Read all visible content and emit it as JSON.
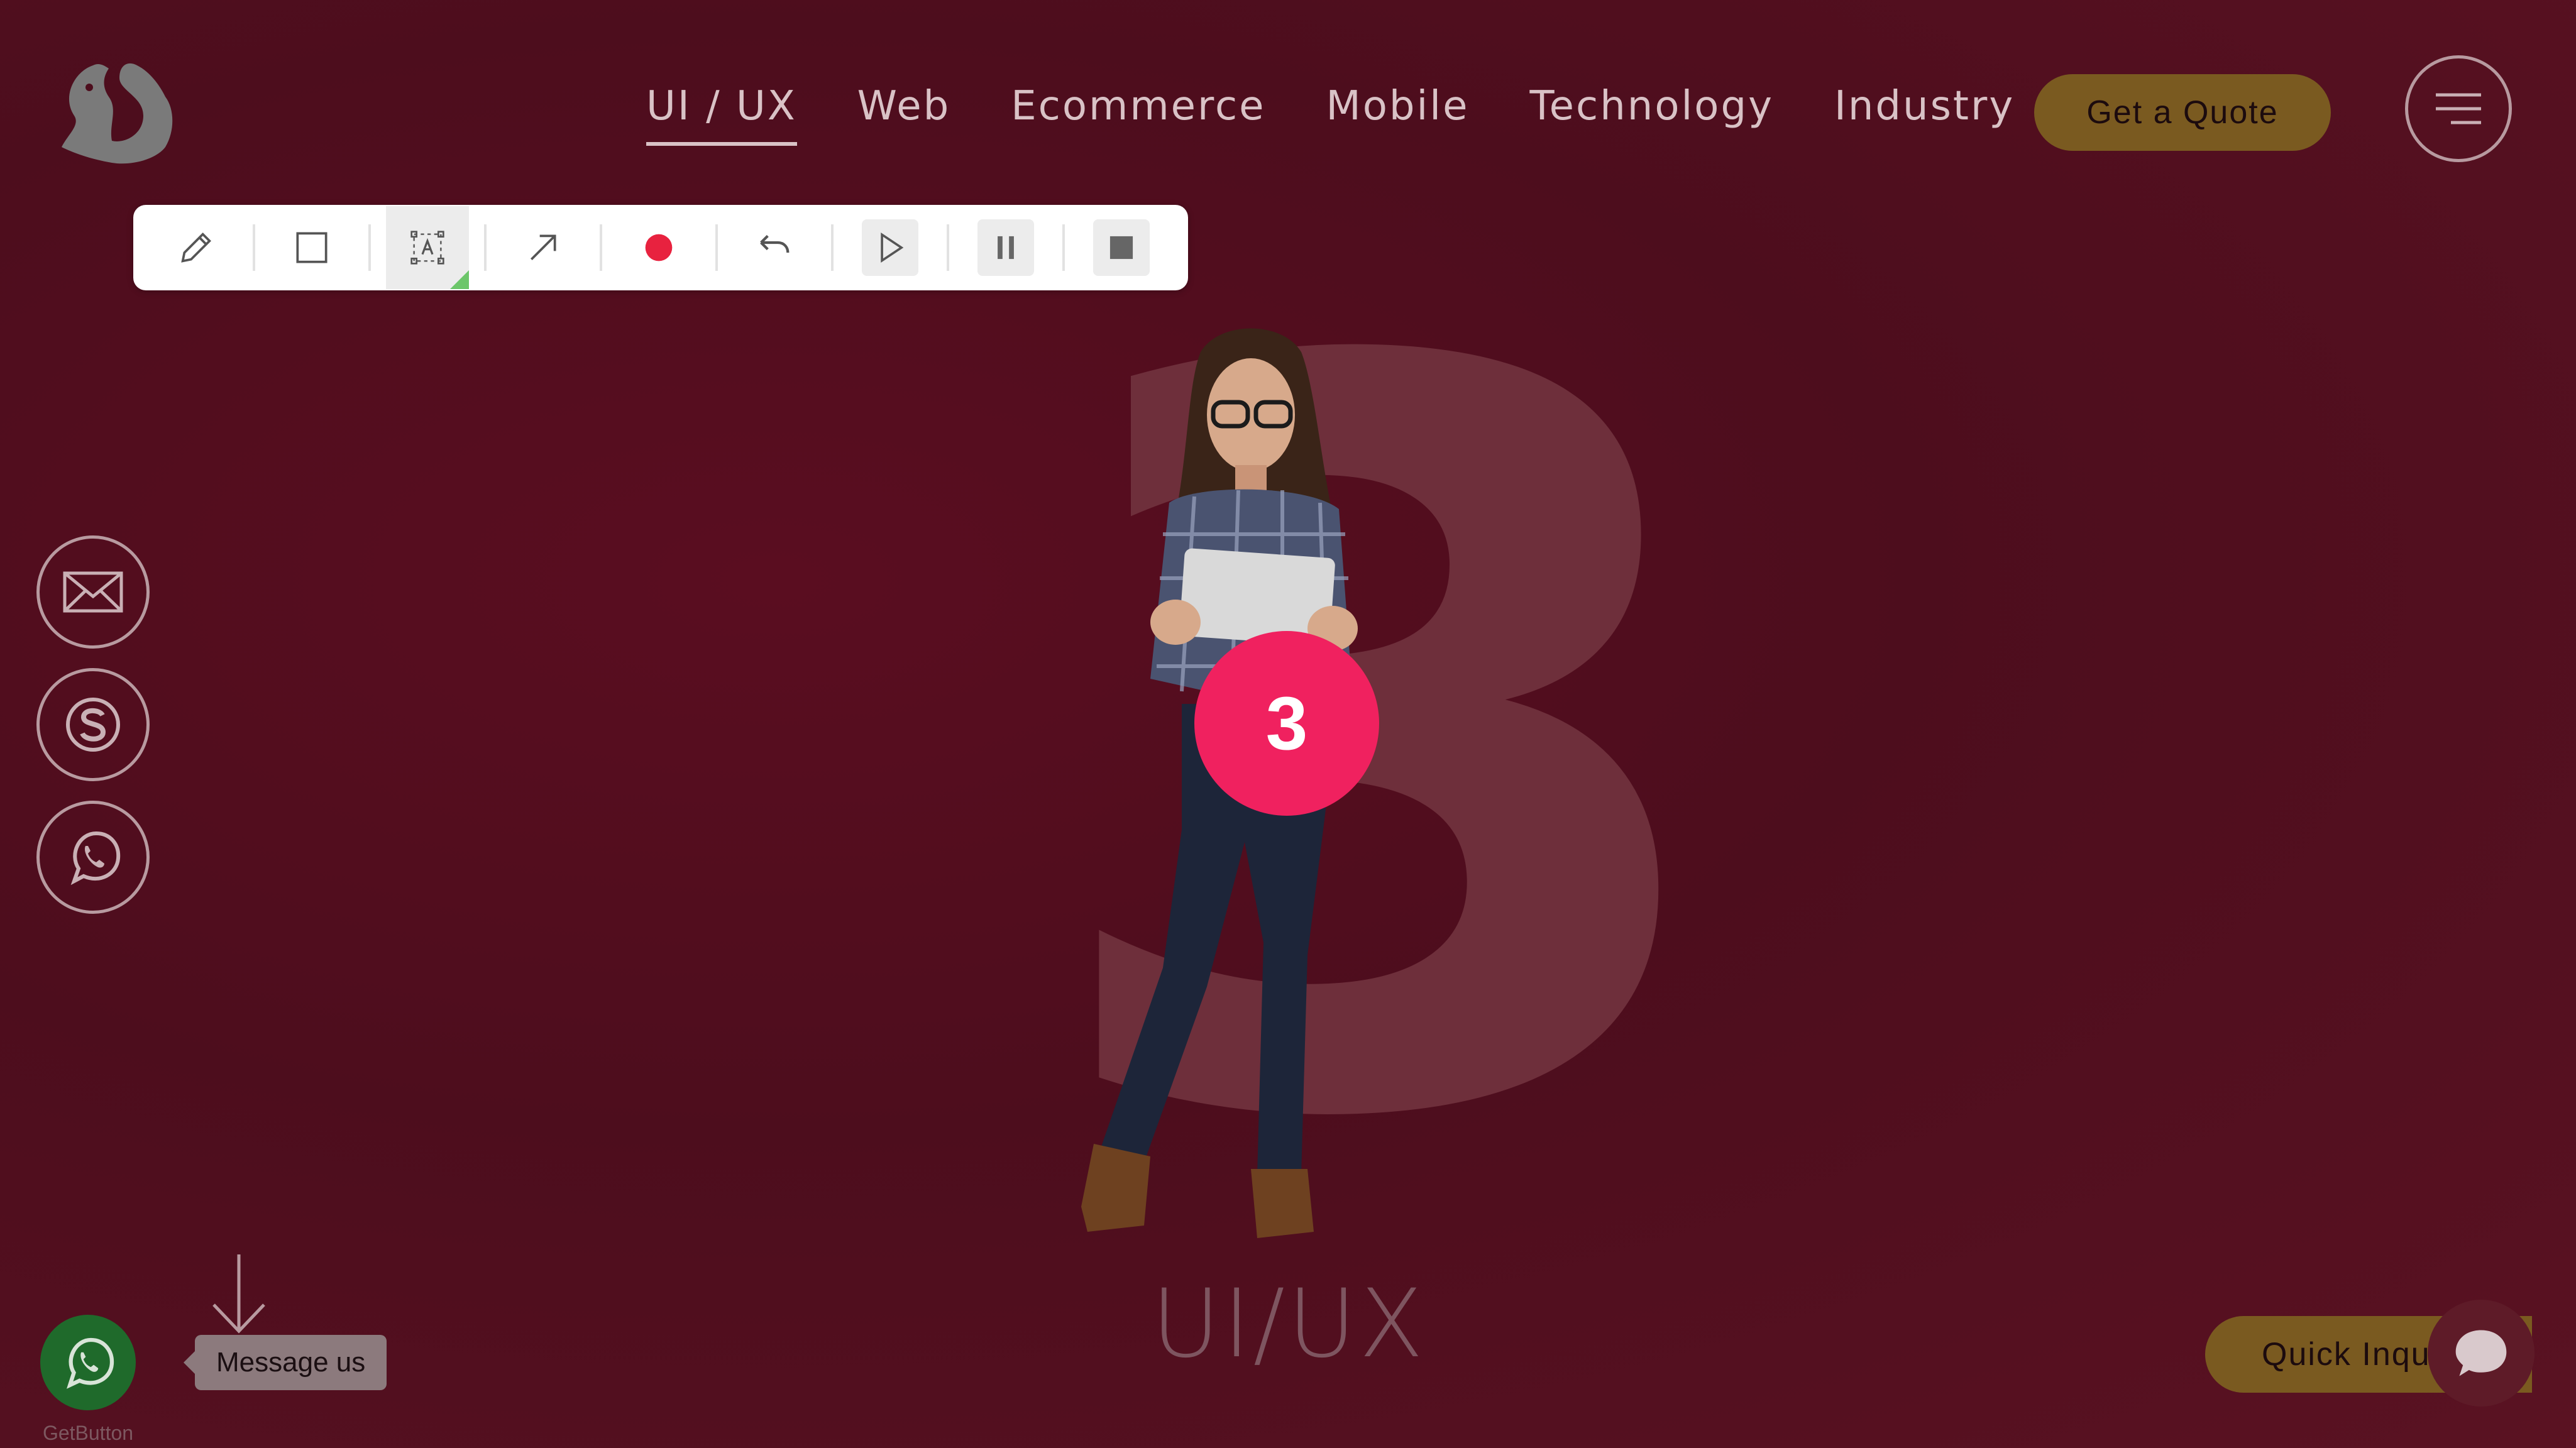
{
  "nav": {
    "items": [
      {
        "label": "UI / UX",
        "active": true
      },
      {
        "label": "Web",
        "active": false
      },
      {
        "label": "Ecommerce",
        "active": false
      },
      {
        "label": "Mobile",
        "active": false
      },
      {
        "label": "Technology",
        "active": false
      },
      {
        "label": "Industry",
        "active": false
      }
    ],
    "quote_label": "Get a Quote",
    "menu_icon": "hamburger-icon"
  },
  "toolbar": {
    "tools": [
      "pencil-icon",
      "rectangle-icon",
      "text-box-icon",
      "arrow-icon",
      "record-icon",
      "undo-icon",
      "play-icon",
      "pause-icon",
      "stop-icon"
    ],
    "selected_tool": "text-box-icon",
    "record_color": "#e8223f"
  },
  "hero": {
    "big_number": "3",
    "step_badge": "3",
    "caption": "UI/UX"
  },
  "socials": [
    "mail-icon",
    "skype-icon",
    "whatsapp-icon"
  ],
  "widget": {
    "message_label": "Message us",
    "powered_by": "GetButton"
  },
  "quick_inquiry_label": "Quick Inquiry",
  "colors": {
    "background": "#520e1f",
    "gold": "#7a5a20",
    "badge": "#f0215f",
    "whatsapp_green": "#1f6a2b"
  }
}
